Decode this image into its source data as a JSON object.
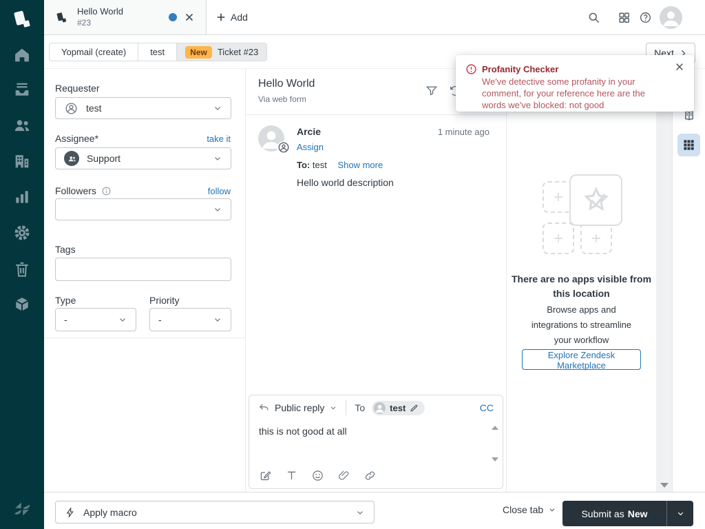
{
  "topbar": {
    "tab_title": "Hello World",
    "tab_subtitle": "#23",
    "add_label": "Add"
  },
  "breadcrumb": {
    "segment1": "Yopmail (create)",
    "segment2": "test",
    "badge": "New",
    "segment3": "Ticket #23",
    "next_label": "Next"
  },
  "fields": {
    "requester_label": "Requester",
    "requester_value": "test",
    "assignee_label": "Assignee*",
    "assignee_action": "take it",
    "assignee_value": "Support",
    "followers_label": "Followers",
    "followers_action": "follow",
    "tags_label": "Tags",
    "type_label": "Type",
    "type_value": "-",
    "priority_label": "Priority",
    "priority_value": "-"
  },
  "conversation": {
    "title": "Hello World",
    "channel": "Via web form",
    "author": "Arcie",
    "timestamp": "1 minute ago",
    "assign_label": "Assign",
    "to_label": "To:",
    "to_value": "test",
    "show_more_label": "Show more",
    "body": "Hello world description"
  },
  "composer": {
    "mode_label": "Public reply",
    "to_label": "To",
    "recipient": "test",
    "cc_label": "CC",
    "draft_text": "this is not good at all"
  },
  "apps_panel": {
    "empty_title": "There are no apps visible from this location",
    "empty_body": "Browse apps and integrations to streamline your workflow",
    "cta_label": "Explore Zendesk Marketplace"
  },
  "notification": {
    "title": "Profanity Checker",
    "message": "We've detective some profanity in your comment, for your reference here are the words we've blocked: not good"
  },
  "footer": {
    "macro_label": "Apply macro",
    "close_tab_label": "Close tab",
    "submit_label": "Submit as",
    "submit_status": "New"
  },
  "colors": {
    "sidebar_teal": "#03363d",
    "accent_blue": "#1f73b7",
    "badge_orange": "#ffb648",
    "error_red": "#cc3340",
    "submit_dark": "#28323a",
    "unsaved_dot_blue": "#337fbd"
  }
}
